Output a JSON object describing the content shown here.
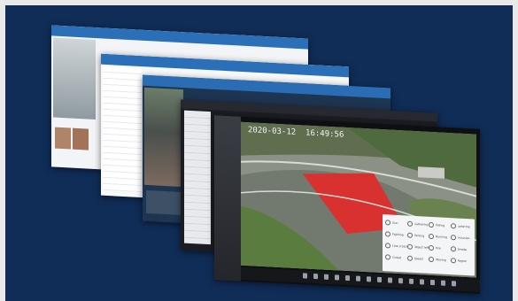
{
  "accent": "#102d57",
  "window1": {
    "tabs": [
      "",
      "",
      ""
    ]
  },
  "window2": {
    "tabs": [
      "",
      "",
      "",
      ""
    ]
  },
  "window3": {
    "tabs": [
      "",
      "",
      ""
    ]
  },
  "window4": {
    "title": ""
  },
  "camera": {
    "timestamp": "2020-03-12  16:49:56",
    "events": [
      "Gun",
      "Gathering",
      "Falling",
      "Loitering",
      "Fighting",
      "Parking",
      "Running",
      "Intrusion",
      "Line crossing",
      "Object left",
      "Fire",
      "Smoke",
      "Crowd",
      "Speed",
      "Waving",
      "Region"
    ]
  }
}
